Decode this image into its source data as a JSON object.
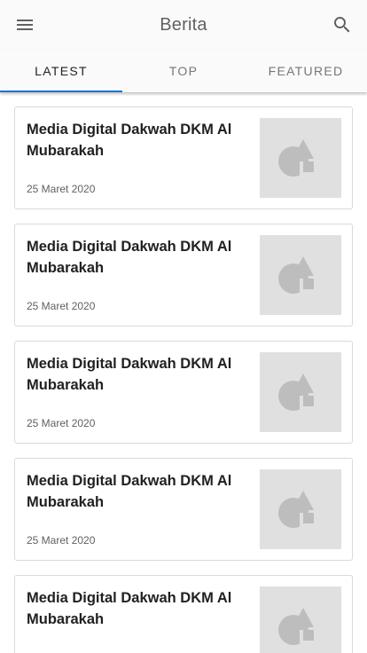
{
  "appbar": {
    "title": "Berita",
    "menu_icon": "menu-icon",
    "search_icon": "search-icon"
  },
  "tabs": [
    {
      "label": "LATEST",
      "active": true
    },
    {
      "label": "TOP",
      "active": false
    },
    {
      "label": "FEATURED",
      "active": false
    }
  ],
  "articles": [
    {
      "title": "Media Digital Dakwah DKM Al Mubarakah",
      "date": "25 Maret 2020",
      "thumbnail_icon": "image-placeholder-icon"
    },
    {
      "title": "Media Digital Dakwah DKM Al Mubarakah",
      "date": "25 Maret 2020",
      "thumbnail_icon": "image-placeholder-icon"
    },
    {
      "title": "Media Digital Dakwah DKM Al Mubarakah",
      "date": "25 Maret 2020",
      "thumbnail_icon": "image-placeholder-icon"
    },
    {
      "title": "Media Digital Dakwah DKM Al Mubarakah",
      "date": "25 Maret 2020",
      "thumbnail_icon": "image-placeholder-icon"
    },
    {
      "title": "Media Digital Dakwah DKM Al Mubarakah",
      "date": "",
      "thumbnail_icon": "image-placeholder-icon"
    }
  ],
  "colors": {
    "accent": "#1e74d2",
    "appbar_bg": "#fafafa",
    "placeholder_bg": "#e0e0e0",
    "placeholder_shape": "#bdbdbd"
  }
}
